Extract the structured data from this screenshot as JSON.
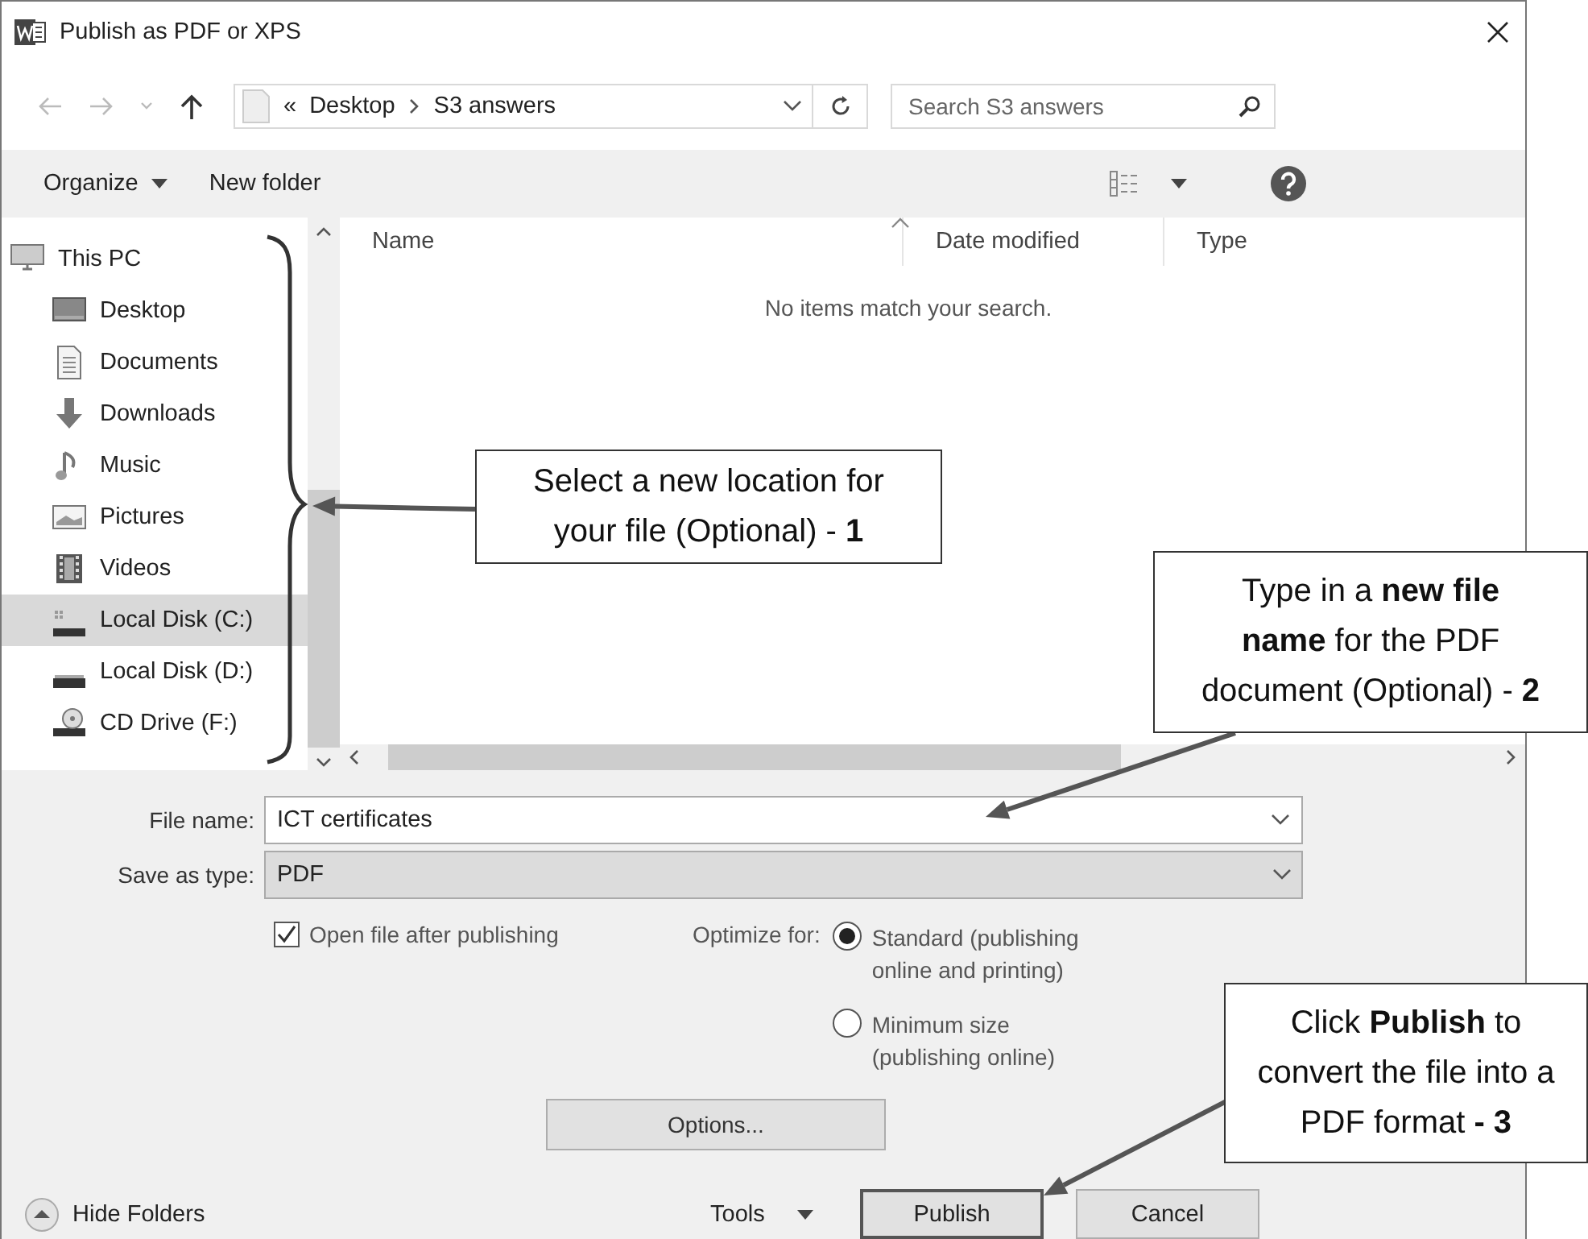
{
  "window": {
    "title": "Publish as PDF or XPS"
  },
  "address_bar": {
    "overflow": "«",
    "path": [
      "Desktop",
      "S3 answers"
    ]
  },
  "search": {
    "placeholder": "Search S3 answers"
  },
  "toolbar": {
    "organize": "Organize",
    "new_folder": "New folder"
  },
  "nav_pane": {
    "items": [
      {
        "label": "This PC",
        "kind": "pc",
        "selected": false,
        "children": [
          {
            "label": "Desktop",
            "kind": "desktop",
            "selected": false
          },
          {
            "label": "Documents",
            "kind": "documents",
            "selected": false
          },
          {
            "label": "Downloads",
            "kind": "downloads",
            "selected": false
          },
          {
            "label": "Music",
            "kind": "music",
            "selected": false
          },
          {
            "label": "Pictures",
            "kind": "pictures",
            "selected": false
          },
          {
            "label": "Videos",
            "kind": "videos",
            "selected": false
          },
          {
            "label": "Local Disk (C:)",
            "kind": "system_disk",
            "selected": true
          },
          {
            "label": "Local Disk (D:)",
            "kind": "disk",
            "selected": false
          },
          {
            "label": "CD Drive (F:)",
            "kind": "cd",
            "selected": false
          }
        ]
      }
    ]
  },
  "file_list": {
    "columns": [
      "Name",
      "Date modified",
      "Type"
    ],
    "empty_message": "No items match your search."
  },
  "form": {
    "file_name": {
      "label": "File name:",
      "value": "ICT certificates"
    },
    "save_type": {
      "label": "Save as type:",
      "value": "PDF"
    },
    "open_after": {
      "label": "Open file after publishing",
      "checked": true
    },
    "optimize": {
      "label": "Optimize for:",
      "options": [
        {
          "label": "Standard (publishing online and printing)",
          "selected": true
        },
        {
          "label": "Minimum size (publishing online)",
          "selected": false
        }
      ]
    },
    "options_button": {
      "label": "Options..."
    }
  },
  "footer": {
    "hide_folders": "Hide Folders",
    "tools": {
      "label": "Tools"
    },
    "buttons": [
      {
        "label": "Publish",
        "default": true
      },
      {
        "label": "Cancel",
        "default": false
      }
    ]
  },
  "callouts": [
    {
      "text": "Select a new location for your file (Optional) - **1**"
    },
    {
      "text": "Type in a **new file name** for the PDF document (Optional) - **2**"
    },
    {
      "text": "Click **Publish** to convert the file into a PDF format **- 3**"
    }
  ]
}
